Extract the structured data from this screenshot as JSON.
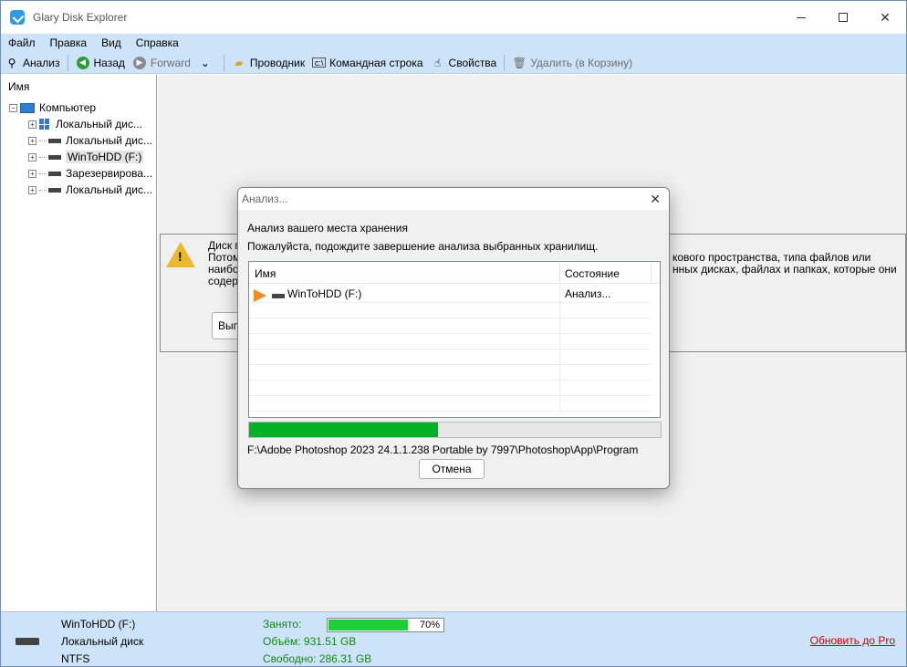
{
  "window": {
    "title": "Glary Disk Explorer"
  },
  "menu": [
    "Файл",
    "Правка",
    "Вид",
    "Справка"
  ],
  "toolbar": {
    "analyze": "Анализ",
    "back": "Назад",
    "forward": "Forward",
    "explorer": "Проводник",
    "cmd": "Командная строка",
    "properties": "Свойства",
    "delete": "Удалить (в Корзину)"
  },
  "tree": {
    "header": "Имя",
    "root": "Компьютер",
    "items": [
      "Локальный дис...",
      "Локальный дис...",
      "WinToHDD (F:)",
      "Зарезервирова...",
      "Локальный дис..."
    ]
  },
  "info": {
    "lines": [
      "Диск п",
      "Потом",
      "наибол",
      "содерж"
    ],
    "right_lines": [
      "кового пространства, типа файлов или",
      "нных дисках, файлах и папках, которые они"
    ],
    "button": "Выпо"
  },
  "dialog": {
    "title": "Анализ...",
    "heading": "Анализ вашего места хранения",
    "subheading": "Пожалуйста, подождите завершение анализа выбранных хранилищ.",
    "columns": [
      "Имя",
      "Состояние"
    ],
    "rows": [
      {
        "name": "WinToHDD (F:)",
        "status": "Анализ..."
      }
    ],
    "progress": 0.46,
    "path": "F:\\Adobe Photoshop 2023 24.1.1.238 Portable by 7997\\Photoshop\\App\\Program",
    "cancel": "Отмена"
  },
  "status": {
    "drive_name": "WinToHDD (F:)",
    "drive_type": "Локальный диск",
    "fs": "NTFS",
    "used_label": "Занято:",
    "used_pct": 70,
    "used_pct_text": "70%",
    "volume": "Объём: 931.51 GB",
    "free": "Свободно: 286.31 GB",
    "upgrade": "Обновить до Pro"
  },
  "colors": {
    "chrome": "#cde3f7",
    "progress": "#06b025",
    "link": "#d40000"
  }
}
